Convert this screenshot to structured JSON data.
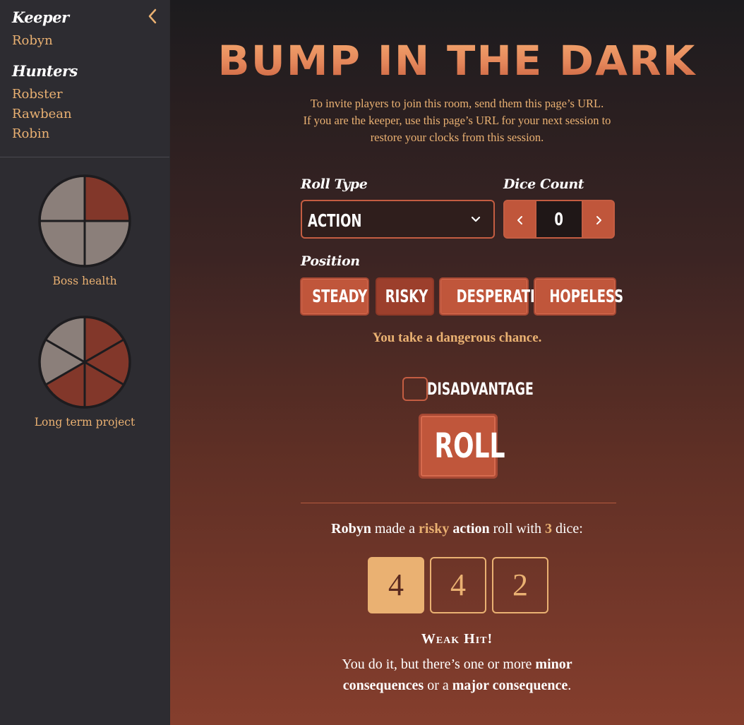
{
  "sidebar": {
    "keeper_heading": "Keeper",
    "keeper_name": "Robyn",
    "hunters_heading": "Hunters",
    "hunters": [
      "Robster",
      "Rawbean",
      "Robin"
    ],
    "clocks": [
      {
        "label": "Boss health",
        "segments": 4,
        "filled": 1
      },
      {
        "label": "Long term project",
        "segments": 6,
        "filled": 4
      }
    ]
  },
  "main": {
    "title": "BUMP IN THE DARK",
    "intro_lines": [
      "To invite players to join this room, send them this page’s URL.",
      "If you are the keeper, use this page’s URL for your next session to",
      "restore your clocks from this session."
    ],
    "roll_type_label": "Roll Type",
    "roll_type_value": "ACTION",
    "dice_count_label": "Dice Count",
    "dice_count_value": "0",
    "position_label": "Position",
    "positions": [
      "STEADY",
      "RISKY",
      "DESPERATE",
      "HOPELESS"
    ],
    "selected_position": "RISKY",
    "position_description": "You take a dangerous chance.",
    "disadvantage_label": "DISADVANTAGE",
    "roll_button": "ROLL"
  },
  "result": {
    "player": "Robyn",
    "text_made_a": "made a",
    "position": "risky",
    "roll_type": "action",
    "text_roll_with": "roll with",
    "dice_count": "3",
    "text_dice": "dice:",
    "dice": [
      "4",
      "4",
      "2"
    ],
    "highest_index": 0,
    "outcome_title": "Weak Hit!",
    "outcome_parts": {
      "p1": "You do it, but there’s one or more",
      "b1": "minor",
      "b2": "consequences",
      "p2": "or a",
      "b3": "major consequence",
      "p3": "."
    }
  },
  "colors": {
    "accent": "#c0563b",
    "gold": "#eab172",
    "clock_filled": "#82372a",
    "clock_empty": "#8b7f7a"
  }
}
